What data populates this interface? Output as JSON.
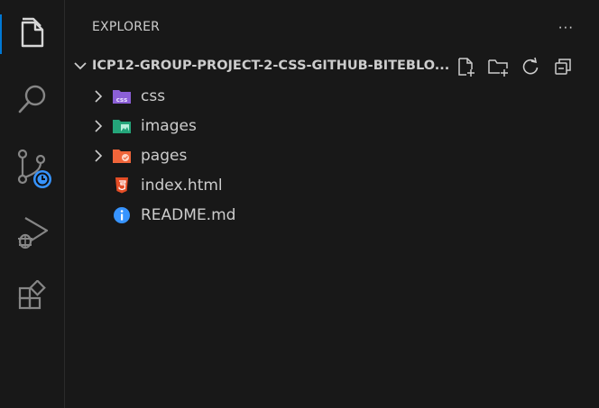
{
  "explorer": {
    "header": "EXPLORER",
    "more_actions": "···",
    "root_folder": "ICP12-GROUP-PROJECT-2-CSS-GITHUB-BITEBLO...",
    "items": [
      {
        "label": "css",
        "type": "folder",
        "icon": "css-folder-icon"
      },
      {
        "label": "images",
        "type": "folder",
        "icon": "images-folder-icon"
      },
      {
        "label": "pages",
        "type": "folder",
        "icon": "pages-folder-icon"
      },
      {
        "label": "index.html",
        "type": "file",
        "icon": "html5-icon"
      },
      {
        "label": "README.md",
        "type": "file",
        "icon": "info-icon"
      }
    ]
  },
  "colors": {
    "accent": "#0078d4",
    "background": "#181818",
    "css_folder": "#8b5fd6",
    "images_folder": "#24a57a",
    "pages_folder": "#f0653a",
    "html_icon": "#e44d26",
    "info_icon": "#3794ff",
    "source_control_badge": "#3794ff"
  }
}
